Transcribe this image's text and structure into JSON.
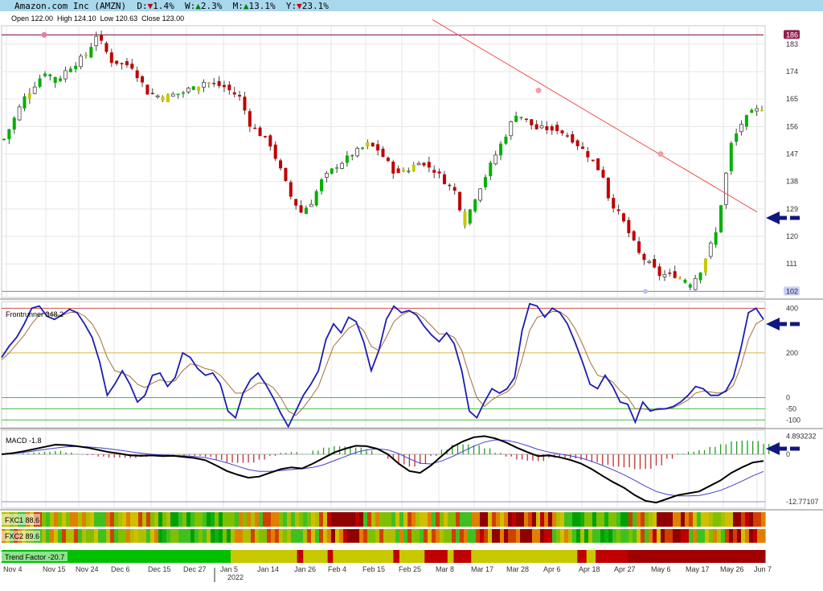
{
  "header": {
    "title": "Amazon.com Inc (AMZN)",
    "d_label": "D:",
    "d_value": "1.4%",
    "w_label": "W:",
    "w_value": "2.3%",
    "m_label": "M:",
    "m_value": "13.1%",
    "y_label": "Y:",
    "y_value": "23.1%",
    "ohlc": "Open 122.00  High 124.10  Low 120.63  Close 123.00"
  },
  "colors": {
    "header_bg": "#a9d7ec",
    "bull": "#00b000",
    "neutral": "#c8c800",
    "bear": "#c00000",
    "frontrunner_line": "#1c1cb4",
    "frontrunner_signal": "#a0703c",
    "macd_line": "#000000",
    "macd_signal": "#4040d0",
    "resistance": "#f05050",
    "arrow": "#101880"
  },
  "chart_data": [
    {
      "type": "candlestick",
      "title": "Amazon.com Inc (AMZN)",
      "ylim": [
        100,
        189
      ],
      "ticks": [
        "183",
        "174",
        "165",
        "156",
        "147",
        "138",
        "129",
        "120",
        "111",
        "102"
      ],
      "tick_values": [
        183,
        174,
        165,
        156,
        147,
        138,
        129,
        120,
        111,
        102
      ],
      "high_marker": "186",
      "high_value": 186,
      "low_marker": "102",
      "low_value": 102,
      "resistance_line": {
        "from_date": "Mar 8",
        "from_value": 191,
        "to_date": "Jun 7",
        "to_value": 128
      },
      "anchors": [
        {
          "d": 0,
          "v": 117
        },
        {
          "d": 4,
          "v": 125
        },
        {
          "d": 8,
          "v": 130
        },
        {
          "d": 10,
          "v": 128
        },
        {
          "d": 13,
          "v": 131
        },
        {
          "d": 16,
          "v": 133
        },
        {
          "d": 18,
          "v": 137
        },
        {
          "d": 21,
          "v": 132
        },
        {
          "d": 25,
          "v": 131
        },
        {
          "d": 28,
          "v": 126
        },
        {
          "d": 31,
          "v": 125
        },
        {
          "d": 35,
          "v": 126
        },
        {
          "d": 39,
          "v": 128
        },
        {
          "d": 43,
          "v": 127
        },
        {
          "d": 46,
          "v": 125
        },
        {
          "d": 48,
          "v": 120
        },
        {
          "d": 52,
          "v": 116
        },
        {
          "d": 54,
          "v": 111
        },
        {
          "d": 56,
          "v": 106
        },
        {
          "d": 58,
          "v": 103
        },
        {
          "d": 60,
          "v": 105
        },
        {
          "d": 62,
          "v": 109
        },
        {
          "d": 65,
          "v": 112
        },
        {
          "d": 68,
          "v": 114
        },
        {
          "d": 71,
          "v": 116
        },
        {
          "d": 73,
          "v": 115
        },
        {
          "d": 76,
          "v": 111
        },
        {
          "d": 79,
          "v": 111
        },
        {
          "d": 81,
          "v": 113
        },
        {
          "d": 84,
          "v": 111
        },
        {
          "d": 88,
          "v": 107
        },
        {
          "d": 90,
          "v": 101
        },
        {
          "d": 92,
          "v": 106
        },
        {
          "d": 95,
          "v": 112
        },
        {
          "d": 98,
          "v": 118
        },
        {
          "d": 100,
          "v": 122
        },
        {
          "d": 104,
          "v": 119
        },
        {
          "d": 108,
          "v": 119
        },
        {
          "d": 111,
          "v": 117
        },
        {
          "d": 114,
          "v": 114
        },
        {
          "d": 117,
          "v": 110
        },
        {
          "d": 118,
          "v": 106
        },
        {
          "d": 121,
          "v": 101
        },
        {
          "d": 124,
          "v": 95
        },
        {
          "d": 126,
          "v": 93
        },
        {
          "d": 128,
          "v": 91
        },
        {
          "d": 131,
          "v": 91
        },
        {
          "d": 134,
          "v": 89
        },
        {
          "d": 136,
          "v": 92
        },
        {
          "d": 139,
          "v": 99
        },
        {
          "d": 142,
          "v": 116
        },
        {
          "d": 144,
          "v": 120
        },
        {
          "d": 146,
          "v": 122
        },
        {
          "d": 148,
          "v": 123
        }
      ],
      "price_scale": {
        "anchor_min": 89,
        "anchor_max": 137,
        "price_min": 104,
        "price_max": 186
      }
    },
    {
      "type": "line",
      "title": "Frontrunner",
      "value_label": "348.2",
      "ylim": [
        -135,
        430
      ],
      "ticks": [
        "400",
        "200",
        "0",
        "-50",
        "-100"
      ],
      "tick_values": [
        400,
        200,
        0,
        -50,
        -100
      ],
      "levels": [
        400,
        200,
        0,
        -50,
        -100
      ],
      "series": [
        {
          "values": [
            180,
            230,
            270,
            330,
            400,
            410,
            365,
            350,
            370,
            395,
            380,
            330,
            270,
            160,
            10,
            60,
            120,
            60,
            -20,
            10,
            100,
            110,
            50,
            90,
            200,
            180,
            130,
            100,
            110,
            60,
            -60,
            -90,
            20,
            80,
            110,
            60,
            0,
            -70,
            -130,
            -60,
            10,
            60,
            120,
            260,
            330,
            290,
            360,
            340,
            250,
            120,
            210,
            350,
            410,
            380,
            390,
            370,
            320,
            280,
            250,
            290,
            240,
            120,
            -60,
            -90,
            -20,
            40,
            20,
            40,
            90,
            300,
            420,
            410,
            360,
            400,
            380,
            330,
            250,
            160,
            60,
            40,
            100,
            50,
            -20,
            -30,
            -110,
            -20,
            -60,
            -50,
            -50,
            -40,
            -20,
            10,
            50,
            40,
            10,
            10,
            30,
            90,
            220,
            380,
            400,
            350
          ]
        },
        {
          "values": [
            170,
            200,
            240,
            280,
            330,
            370,
            380,
            370,
            368,
            380,
            383,
            365,
            330,
            270,
            180,
            120,
            110,
            95,
            60,
            45,
            65,
            80,
            70,
            75,
            120,
            150,
            145,
            130,
            122,
            100,
            60,
            20,
            20,
            40,
            65,
            65,
            45,
            0,
            -60,
            -80,
            -45,
            0,
            50,
            140,
            230,
            270,
            310,
            330,
            300,
            230,
            210,
            270,
            340,
            370,
            385,
            380,
            355,
            320,
            285,
            285,
            270,
            210,
            100,
            0,
            -40,
            -10,
            10,
            25,
            60,
            170,
            300,
            360,
            370,
            385,
            385,
            360,
            310,
            240,
            160,
            100,
            90,
            70,
            30,
            0,
            -50,
            -50,
            -55,
            -55,
            -52,
            -45,
            -30,
            -10,
            20,
            30,
            25,
            20,
            25,
            55,
            140,
            260,
            330,
            350
          ]
        }
      ]
    },
    {
      "type": "line",
      "title": "MACD",
      "value_label": "-1.8",
      "ylim": [
        -14.5,
        6.5
      ],
      "ticks": [
        "4.893232",
        "0",
        "-12.77107"
      ],
      "tick_values": [
        4.893232,
        0,
        -12.77107
      ],
      "series": [
        {
          "values": [
            0,
            0.3,
            0.8,
            1.4,
            2.0,
            2.6,
            2.5,
            2.2,
            1.8,
            1.2,
            0.6,
            0.2,
            -0.3,
            -0.4,
            -0.3,
            -0.5,
            -0.4,
            -0.7,
            -1.0,
            -1.6,
            -3.0,
            -4.5,
            -5.5,
            -6.3,
            -6.0,
            -5.0,
            -4.0,
            -3.5,
            -3.8,
            -2.5,
            -1.0,
            0.5,
            1.5,
            2.3,
            2.2,
            1.5,
            0,
            -2.5,
            -4.5,
            -5.0,
            -3.0,
            -0.5,
            2.0,
            3.5,
            4.6,
            4.9,
            4.3,
            3.2,
            1.8,
            0.6,
            -0.5,
            -0.3,
            -0.8,
            -1.5,
            -2.5,
            -4.0,
            -5.8,
            -7.5,
            -9.0,
            -11.0,
            -12.5,
            -13.0,
            -12.0,
            -11.0,
            -10.5,
            -10.0,
            -8.5,
            -7.0,
            -5.0,
            -3.5,
            -2.2,
            -1.8
          ]
        },
        {
          "values": [
            0,
            0.2,
            0.5,
            0.9,
            1.3,
            1.7,
            2.0,
            2.1,
            2.0,
            1.8,
            1.5,
            1.1,
            0.7,
            0.3,
            0.0,
            -0.2,
            -0.3,
            -0.4,
            -0.6,
            -0.9,
            -1.5,
            -2.3,
            -3.2,
            -4.1,
            -4.6,
            -4.6,
            -4.4,
            -4.1,
            -3.9,
            -3.5,
            -2.8,
            -1.7,
            -0.6,
            0.5,
            1.2,
            1.5,
            1.2,
            0.2,
            -1.2,
            -2.4,
            -2.6,
            -1.8,
            -0.6,
            0.8,
            2.2,
            3.3,
            3.9,
            3.8,
            3.2,
            2.3,
            1.3,
            0.6,
            0.1,
            -0.4,
            -1.0,
            -1.9,
            -3.0,
            -4.2,
            -5.5,
            -7.0,
            -8.6,
            -10.0,
            -10.8,
            -11.2,
            -11.2,
            -11.1,
            -10.5,
            -9.7,
            -8.5,
            -7.2,
            -5.8,
            -4.6
          ]
        }
      ],
      "histogram": [
        0,
        0.1,
        0.3,
        0.5,
        0.7,
        0.9,
        0.5,
        0.1,
        -0.2,
        -0.6,
        -0.9,
        -0.9,
        -1.0,
        -0.7,
        -0.3,
        -0.3,
        -0.1,
        -0.3,
        -0.4,
        -0.7,
        -1.5,
        -2.2,
        -2.3,
        -2.2,
        -1.4,
        -0.4,
        0.4,
        0.6,
        0.1,
        1.0,
        1.8,
        2.2,
        2.1,
        1.8,
        1.0,
        0.0,
        -1.2,
        -2.7,
        -3.3,
        -2.6,
        -0.4,
        1.3,
        2.6,
        2.7,
        2.4,
        1.6,
        0.4,
        -0.6,
        -1.4,
        -1.7,
        -1.8,
        -0.9,
        -0.9,
        -1.1,
        -1.5,
        -2.1,
        -2.8,
        -3.3,
        -3.5,
        -4.0,
        -3.9,
        -3.0,
        -1.2,
        0.2,
        0.7,
        1.1,
        2.0,
        2.7,
        3.5,
        3.7,
        3.6,
        2.8
      ]
    }
  ],
  "heat_strips": [
    {
      "label": "FXC1 88.6"
    },
    {
      "label": "FXC2 89.6"
    },
    {
      "label": "Trend Factor -20.7"
    }
  ],
  "trend_segments": [
    {
      "c": "#00c000",
      "f": 0,
      "t": 0.3
    },
    {
      "c": "#c8c800",
      "f": 0.3,
      "t": 0.387
    },
    {
      "c": "#c00000",
      "f": 0.387,
      "t": 0.395
    },
    {
      "c": "#c8c800",
      "f": 0.395,
      "t": 0.427
    },
    {
      "c": "#c00000",
      "f": 0.427,
      "t": 0.434
    },
    {
      "c": "#c8c800",
      "f": 0.434,
      "t": 0.513
    },
    {
      "c": "#c00000",
      "f": 0.513,
      "t": 0.521
    },
    {
      "c": "#c8c800",
      "f": 0.521,
      "t": 0.554
    },
    {
      "c": "#c00000",
      "f": 0.554,
      "t": 0.584
    },
    {
      "c": "#c8c800",
      "f": 0.584,
      "t": 0.592
    },
    {
      "c": "#c00000",
      "f": 0.592,
      "t": 0.615
    },
    {
      "c": "#c8c800",
      "f": 0.615,
      "t": 0.754
    },
    {
      "c": "#c00000",
      "f": 0.754,
      "t": 0.766
    },
    {
      "c": "#c8c800",
      "f": 0.766,
      "t": 0.778
    },
    {
      "c": "#c00000",
      "f": 0.778,
      "t": 0.82
    },
    {
      "c": "#a00000",
      "f": 0.82,
      "t": 1
    }
  ],
  "x_axis": {
    "labels": [
      "Nov 4",
      "Nov 15",
      "Nov 24",
      "Dec 6",
      "Dec 15",
      "Dec 27",
      "Jan 5",
      "Jan 14",
      "Jan 26",
      "Feb 4",
      "Feb 15",
      "Feb 25",
      "Mar 8",
      "Mar 17",
      "Mar 28",
      "Apr 6",
      "Apr 18",
      "Apr 27",
      "May 6",
      "May 17",
      "May 26",
      "Jun 7"
    ],
    "year_label": "2022"
  }
}
